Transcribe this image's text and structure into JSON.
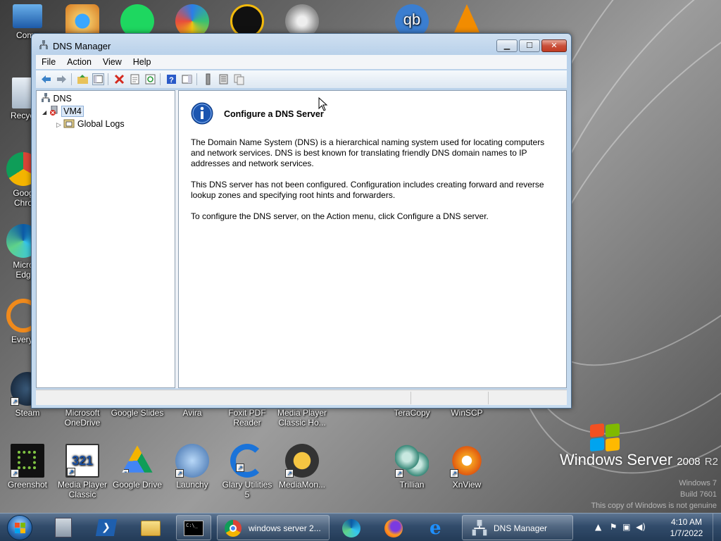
{
  "desktop": {
    "top_row_partial": [
      "Comp",
      "Recycl",
      "Goog",
      "Chro",
      "Micro",
      "Edg",
      "Everyt"
    ],
    "row_labels_1": [
      {
        "label": "Steam",
        "icon": "steam-icon"
      },
      {
        "label": "Microsoft OneDrive",
        "icon": "onedrive-icon"
      },
      {
        "label": "Google Slides",
        "icon": "google-slides-icon"
      },
      {
        "label": "Avira",
        "icon": "avira-icon"
      },
      {
        "label": "Foxit PDF Reader",
        "icon": "foxit-icon"
      },
      {
        "label": "Media Player Classic Ho...",
        "icon": "mpc-icon"
      },
      {
        "label": "TeraCopy",
        "icon": "teracopy-icon"
      },
      {
        "label": "WinSCP",
        "icon": "winscp-icon"
      }
    ],
    "row_icons_2": [
      {
        "label": "Greenshot",
        "icon": "greenshot-icon"
      },
      {
        "label": "Media Player Classic",
        "icon": "mpc-classic-icon"
      },
      {
        "label": "Google Drive",
        "icon": "google-drive-icon"
      },
      {
        "label": "Launchy",
        "icon": "launchy-icon"
      },
      {
        "label": "Glary Utilities 5",
        "icon": "glary-icon"
      },
      {
        "label": "MediaMon...",
        "icon": "mediamonkey-icon"
      },
      {
        "label": "Trillian",
        "icon": "trillian-icon"
      },
      {
        "label": "XnView",
        "icon": "xnview-icon"
      }
    ],
    "branding": {
      "windows": "Windows Server",
      "version": "2008",
      "edition": "R2"
    },
    "watermark": [
      "Windows 7",
      "Build 7601",
      "This copy of Windows is not genuine"
    ]
  },
  "window": {
    "title": "DNS Manager",
    "menu": [
      "File",
      "Action",
      "View",
      "Help"
    ],
    "tree": {
      "root": "DNS",
      "server": "VM4",
      "child": "Global Logs"
    },
    "content": {
      "heading": "Configure a DNS Server",
      "paragraphs": [
        "The Domain Name System (DNS) is a hierarchical naming system used for locating computers and network services. DNS is best known for translating friendly DNS domain names to IP addresses and network services.",
        "This DNS server has not been configured. Configuration includes creating forward and reverse lookup zones and specifying root hints and forwarders.",
        "To configure the DNS server, on the Action menu, click Configure a DNS server."
      ]
    }
  },
  "taskbar": {
    "chrome_label": "windows server 2...",
    "dns_label": "DNS Manager",
    "time": "4:10 AM",
    "date": "1/7/2022"
  },
  "colors": {
    "accent": "#3a6ea5",
    "info_blue": "#1b55b0",
    "delete_red": "#d42a1f"
  }
}
